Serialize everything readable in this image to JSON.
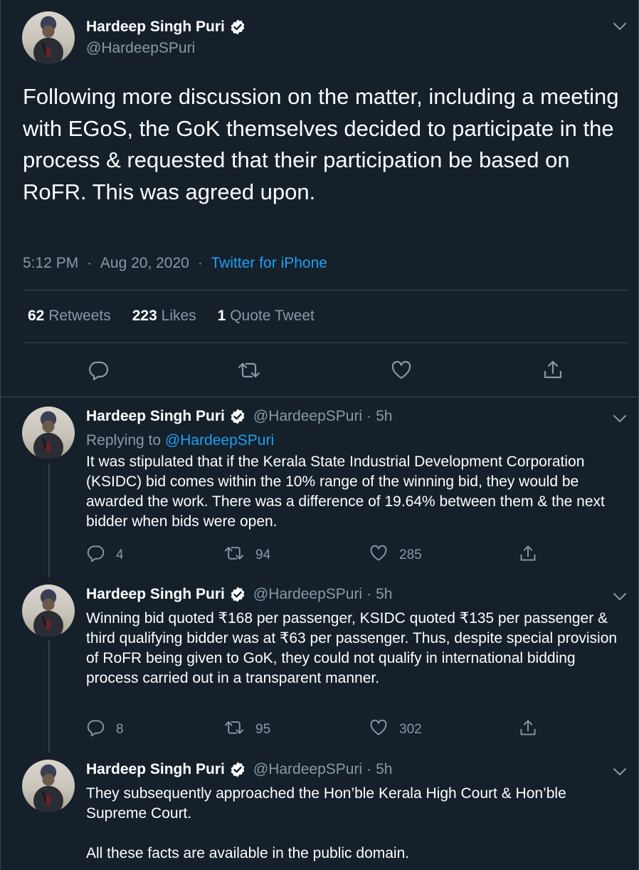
{
  "colors": {
    "background": "#15202b",
    "border": "#38444d",
    "text_primary": "#ffffff",
    "text_secondary": "#8899a6",
    "accent": "#1da1f2"
  },
  "main_tweet": {
    "name": "Hardeep Singh Puri",
    "handle": "@HardeepSPuri",
    "text": "Following more discussion on the matter, including a meeting with EGoS, the GoK themselves decided to participate in the process & requested that their participation be based on RoFR. This was agreed upon.",
    "time": "5:12 PM",
    "date": "Aug 20, 2020",
    "source": "Twitter for iPhone",
    "retweets_count": "62",
    "retweets_label": "Retweets",
    "likes_count": "223",
    "likes_label": "Likes",
    "quotes_count": "1",
    "quotes_label": "Quote Tweet",
    "icons": [
      "reply-icon",
      "retweet-icon",
      "like-icon",
      "share-icon"
    ]
  },
  "replies": [
    {
      "name": "Hardeep Singh Puri",
      "handle": "@HardeepSPuri",
      "age": "5h",
      "replying_label": "Replying to",
      "replying_to": "@HardeepSPuri",
      "text": "It was stipulated that if the Kerala State Industrial Development Corporation (KSIDC) bid comes within the 10% range of the winning bid, they would be awarded the work. There was a difference of 19.64% between them & the next bidder when bids were open.",
      "reply_count": "4",
      "retweet_count": "94",
      "like_count": "285"
    },
    {
      "name": "Hardeep Singh Puri",
      "handle": "@HardeepSPuri",
      "age": "5h",
      "text": "Winning bid quoted ₹168 per passenger, KSIDC quoted ₹135 per passenger & third qualifying bidder was at ₹63 per passenger. Thus, despite special provision of RoFR being given to GoK, they could not qualify in international bidding process carried out in a transparent manner.",
      "reply_count": "8",
      "retweet_count": "95",
      "like_count": "302"
    },
    {
      "name": "Hardeep Singh Puri",
      "handle": "@HardeepSPuri",
      "age": "5h",
      "text_line1": "They subsequently approached the Hon’ble Kerala High Court & Hon’ble Supreme Court.",
      "text_line2": "All these facts are available in the public domain."
    }
  ]
}
